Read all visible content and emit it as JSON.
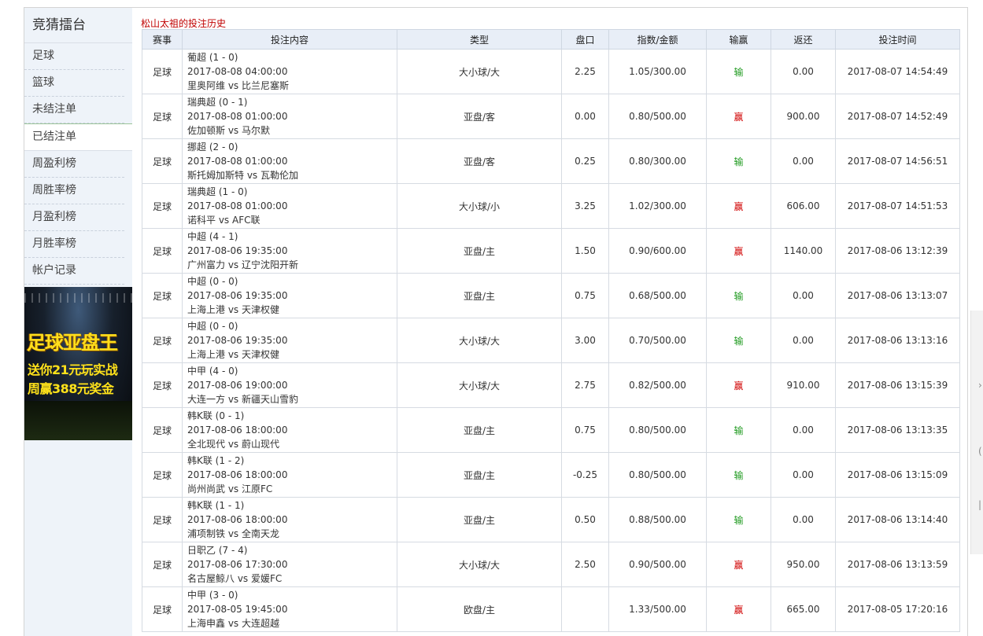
{
  "sidebar": {
    "title": "竞猜擂台",
    "items": [
      {
        "label": "足球"
      },
      {
        "label": "篮球"
      },
      {
        "label": "未结注单"
      },
      {
        "label": "已结注单"
      },
      {
        "label": "周盈利榜"
      },
      {
        "label": "周胜率榜"
      },
      {
        "label": "月盈利榜"
      },
      {
        "label": "月胜率榜"
      },
      {
        "label": "帐户记录"
      }
    ],
    "banner": {
      "line1": "足球亚盘王",
      "line2": "送你21元玩实战",
      "line3": "周赢388元奖金"
    }
  },
  "page": {
    "title": "松山太祖的投注历史"
  },
  "table": {
    "headers": [
      "赛事",
      "投注内容",
      "类型",
      "盘口",
      "指数/金额",
      "输赢",
      "返还",
      "投注时间"
    ],
    "rows": [
      {
        "sport": "足球",
        "league": "葡超 (1 - 0)",
        "time": "2017-08-08 04:00:00",
        "teams": "里奥阿维 vs 比兰尼塞斯",
        "type": "大小球/大",
        "handicap": "2.25",
        "odds": "1.05/300.00",
        "result": "输",
        "result_kind": "lose",
        "return": "0.00",
        "bet_time": "2017-08-07 14:54:49"
      },
      {
        "sport": "足球",
        "league": "瑞典超 (0 - 1)",
        "time": "2017-08-08 01:00:00",
        "teams": "佐加顿斯 vs 马尔默",
        "type": "亚盘/客",
        "handicap": "0.00",
        "odds": "0.80/500.00",
        "result": "赢",
        "result_kind": "win",
        "return": "900.00",
        "bet_time": "2017-08-07 14:52:49"
      },
      {
        "sport": "足球",
        "league": "挪超 (2 - 0)",
        "time": "2017-08-08 01:00:00",
        "teams": "斯托姆加斯特 vs 瓦勒伦加",
        "type": "亚盘/客",
        "handicap": "0.25",
        "odds": "0.80/300.00",
        "result": "输",
        "result_kind": "lose",
        "return": "0.00",
        "bet_time": "2017-08-07 14:56:51"
      },
      {
        "sport": "足球",
        "league": "瑞典超 (1 - 0)",
        "time": "2017-08-08 01:00:00",
        "teams": "诺科平 vs AFC联",
        "type": "大小球/小",
        "handicap": "3.25",
        "odds": "1.02/300.00",
        "result": "赢",
        "result_kind": "win",
        "return": "606.00",
        "bet_time": "2017-08-07 14:51:53"
      },
      {
        "sport": "足球",
        "league": "中超 (4 - 1)",
        "time": "2017-08-06 19:35:00",
        "teams": "广州富力 vs 辽宁沈阳开新",
        "type": "亚盘/主",
        "handicap": "1.50",
        "odds": "0.90/600.00",
        "result": "赢",
        "result_kind": "win",
        "return": "1140.00",
        "bet_time": "2017-08-06 13:12:39"
      },
      {
        "sport": "足球",
        "league": "中超 (0 - 0)",
        "time": "2017-08-06 19:35:00",
        "teams": "上海上港 vs 天津权健",
        "type": "亚盘/主",
        "handicap": "0.75",
        "odds": "0.68/500.00",
        "result": "输",
        "result_kind": "lose",
        "return": "0.00",
        "bet_time": "2017-08-06 13:13:07"
      },
      {
        "sport": "足球",
        "league": "中超 (0 - 0)",
        "time": "2017-08-06 19:35:00",
        "teams": "上海上港 vs 天津权健",
        "type": "大小球/大",
        "handicap": "3.00",
        "odds": "0.70/500.00",
        "result": "输",
        "result_kind": "lose",
        "return": "0.00",
        "bet_time": "2017-08-06 13:13:16"
      },
      {
        "sport": "足球",
        "league": "中甲 (4 - 0)",
        "time": "2017-08-06 19:00:00",
        "teams": "大连一方 vs 新疆天山雪豹",
        "type": "大小球/大",
        "handicap": "2.75",
        "odds": "0.82/500.00",
        "result": "赢",
        "result_kind": "win",
        "return": "910.00",
        "bet_time": "2017-08-06 13:15:39"
      },
      {
        "sport": "足球",
        "league": "韩K联 (0 - 1)",
        "time": "2017-08-06 18:00:00",
        "teams": "全北现代 vs 蔚山现代",
        "type": "亚盘/主",
        "handicap": "0.75",
        "odds": "0.80/500.00",
        "result": "输",
        "result_kind": "lose",
        "return": "0.00",
        "bet_time": "2017-08-06 13:13:35"
      },
      {
        "sport": "足球",
        "league": "韩K联 (1 - 2)",
        "time": "2017-08-06 18:00:00",
        "teams": "尚州尚武 vs 江原FC",
        "type": "亚盘/主",
        "handicap": "-0.25",
        "odds": "0.80/500.00",
        "result": "输",
        "result_kind": "lose",
        "return": "0.00",
        "bet_time": "2017-08-06 13:15:09"
      },
      {
        "sport": "足球",
        "league": "韩K联 (1 - 1)",
        "time": "2017-08-06 18:00:00",
        "teams": "浦项制铁 vs 全南天龙",
        "type": "亚盘/主",
        "handicap": "0.50",
        "odds": "0.88/500.00",
        "result": "输",
        "result_kind": "lose",
        "return": "0.00",
        "bet_time": "2017-08-06 13:14:40"
      },
      {
        "sport": "足球",
        "league": "日职乙 (7 - 4)",
        "time": "2017-08-06 17:30:00",
        "teams": "名古屋鲸八 vs 爱媛FC",
        "type": "大小球/大",
        "handicap": "2.50",
        "odds": "0.90/500.00",
        "result": "赢",
        "result_kind": "win",
        "return": "950.00",
        "bet_time": "2017-08-06 13:13:59"
      },
      {
        "sport": "足球",
        "league": "中甲 (3 - 0)",
        "time": "2017-08-05 19:45:00",
        "teams": "上海申鑫 vs 大连超越",
        "type": "欧盘/主",
        "handicap": "",
        "odds": "1.33/500.00",
        "result": "赢",
        "result_kind": "win",
        "return": "665.00",
        "bet_time": "2017-08-05 17:20:16"
      }
    ]
  },
  "colors": {
    "lose": "#1f9a1f",
    "win": "#d00000",
    "title": "#c00000",
    "header_bg": "#e8eef7",
    "sidebar_bg": "#eef3f9"
  }
}
